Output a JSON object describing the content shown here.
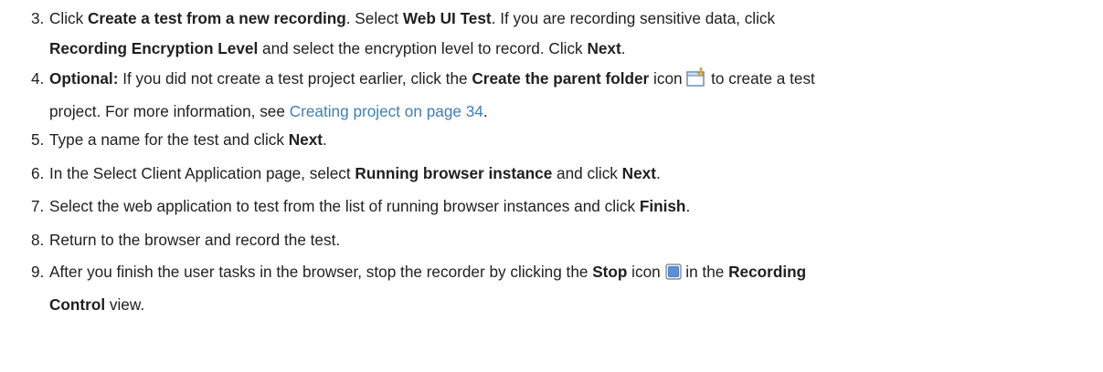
{
  "steps": [
    {
      "number": "3.",
      "line1": {
        "t1": "Click ",
        "b1": "Create a test from a new recording",
        "t2": ". Select ",
        "b2": "Web UI Test",
        "t3": ". If you are recording sensitive data, click"
      },
      "line2": {
        "b1": "Recording Encryption Level",
        "t1": " and select the encryption level to record. Click ",
        "b2": "Next",
        "t2": "."
      }
    },
    {
      "number": "4.",
      "line1": {
        "b1": "Optional:",
        "t1": "  If you did not create a test project earlier, click the ",
        "b2": "Create the parent folder",
        "t2": " icon ",
        "icon": "create-parent-folder-icon",
        "t3": " to create a test"
      },
      "line2": {
        "t1": "project. For more information, see ",
        "link": "Creating project on page 34",
        "t2": "."
      }
    },
    {
      "number": "5.",
      "t1": "Type a name for the test and click ",
      "b1": "Next",
      "t2": "."
    },
    {
      "number": "6.",
      "t1": "In the Select Client Application page, select ",
      "b1": "Running browser instance",
      "t2": " and click ",
      "b2": "Next",
      "t3": "."
    },
    {
      "number": "7.",
      "t1": "Select the web application to test from the list of running browser instances and click ",
      "b1": "Finish",
      "t2": "."
    },
    {
      "number": "8.",
      "t1": "Return to the browser and record the test."
    },
    {
      "number": "9.",
      "line1": {
        "t1": "After you finish the user tasks in the browser, stop the recorder by clicking the  ",
        "b1": "Stop",
        "t2": "  icon ",
        "icon": "stop-icon",
        "t3": " in the ",
        "b2": "Recording"
      },
      "line2": {
        "b1": "Control",
        "t1": " view."
      }
    }
  ],
  "colors": {
    "text": "#1f1f1f",
    "link": "#3f7fb7",
    "stop_icon_fill": "#5b8fd6",
    "folder_icon": "#e9c46a"
  }
}
